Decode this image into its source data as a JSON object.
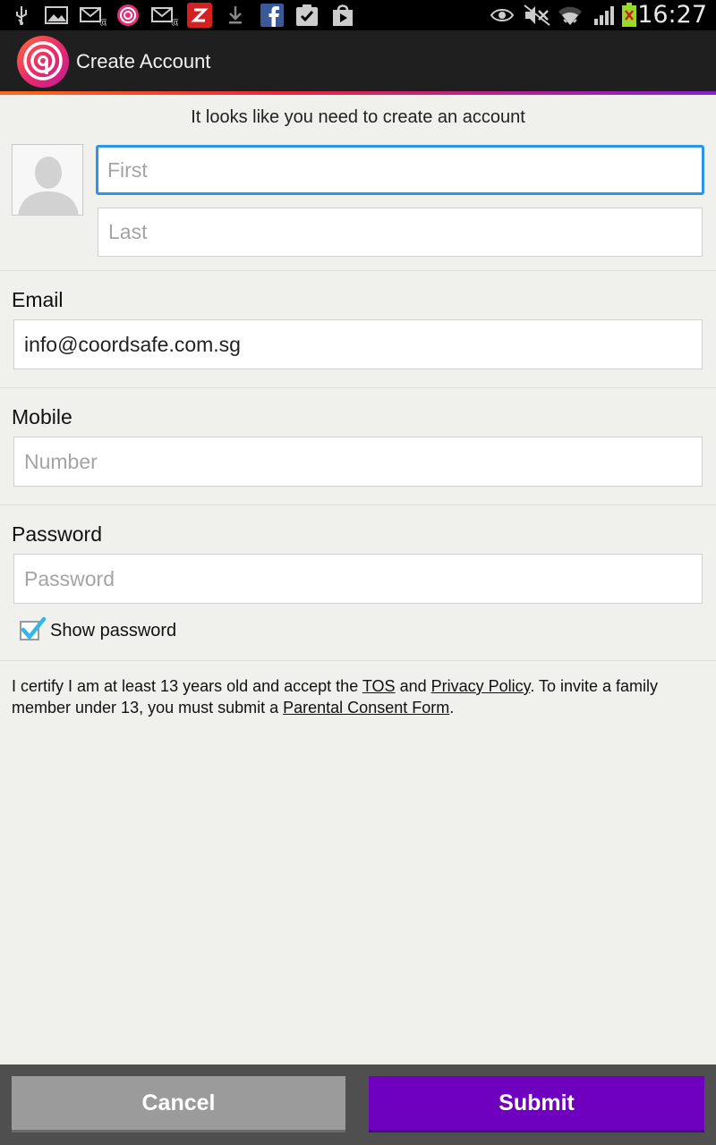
{
  "status_bar": {
    "time": "16:27",
    "icons_left": [
      "usb-icon",
      "gallery-icon",
      "email-icon",
      "life360-icon",
      "email-icon",
      "zinio-icon",
      "download-icon",
      "facebook-icon",
      "tasks-icon",
      "play-store-icon"
    ],
    "icons_right": [
      "eye-icon",
      "mute-icon",
      "wifi-icon",
      "signal-icon",
      "battery-charging-icon"
    ]
  },
  "action_bar": {
    "title": "Create Account",
    "logo": "life360-logo",
    "accent_colors": [
      "#ff6a1a",
      "#e8263c",
      "#b01fa0",
      "#8a1fd0"
    ]
  },
  "form": {
    "intro": "It looks like you need to create an account",
    "first_placeholder": "First",
    "last_placeholder": "Last",
    "email_label": "Email",
    "email_value": "info@coordsafe.com.sg",
    "mobile_label": "Mobile",
    "mobile_placeholder": "Number",
    "password_label": "Password",
    "password_placeholder": "Password",
    "show_password_label": "Show password",
    "show_password_checked": true
  },
  "legal": {
    "text_1": "I certify I am at least 13 years old and accept the ",
    "tos_link": "TOS",
    "text_2": " and ",
    "privacy_link": "Privacy Policy",
    "text_3": ". To invite a family member under 13, you must submit a ",
    "consent_link": "Parental Consent Form",
    "text_4": "."
  },
  "buttons": {
    "cancel": "Cancel",
    "submit": "Submit",
    "submit_color": "#7000bf"
  }
}
